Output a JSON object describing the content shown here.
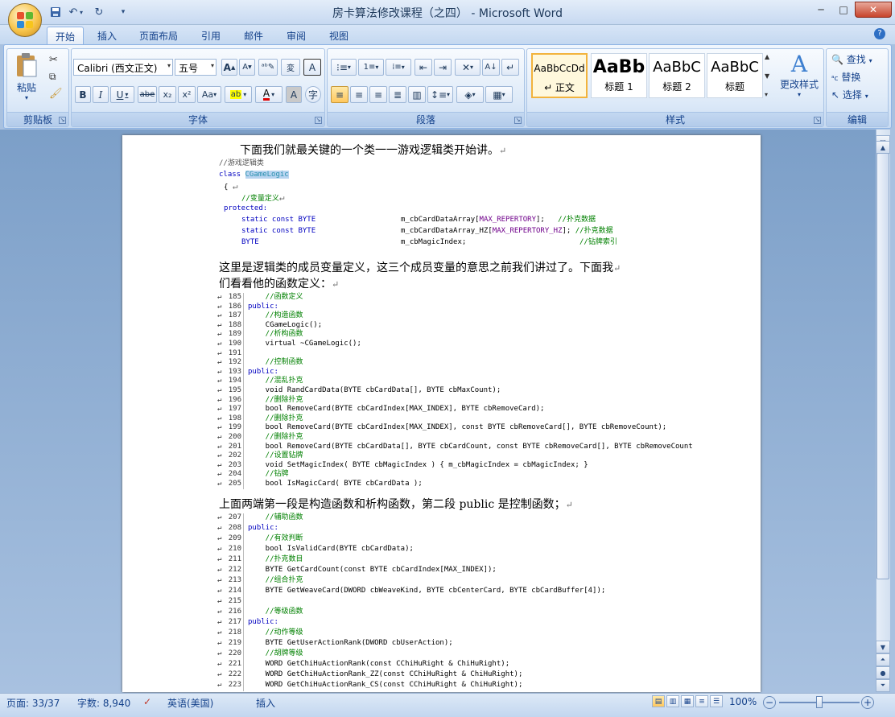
{
  "window": {
    "title": "房卡算法修改课程（之四） - Microsoft Word",
    "min_glyph": "─",
    "max_glyph": "□",
    "close_glyph": "✕"
  },
  "quick_access": {
    "save_icon": "save-icon",
    "undo_icon": "undo-icon",
    "redo_icon": "redo-icon"
  },
  "tabs": [
    "开始",
    "插入",
    "页面布局",
    "引用",
    "邮件",
    "审阅",
    "视图"
  ],
  "ribbon": {
    "clipboard": {
      "paste_label": "粘贴",
      "group_label": "剪贴板"
    },
    "font": {
      "font_name": "Calibri (西文正文)",
      "font_size": "五号",
      "group_label": "字体",
      "bold": "B",
      "italic": "I",
      "underline": "U",
      "strike": "abe",
      "sub": "x₂",
      "sup": "x²",
      "case": "Aa",
      "grow": "A",
      "shrink": "A"
    },
    "paragraph": {
      "group_label": "段落"
    },
    "styles": {
      "group_label": "样式",
      "change_styles": "更改样式",
      "items": [
        {
          "sample": "AaBbCcDd",
          "name": "↵ 正文"
        },
        {
          "sample": "AaBb",
          "name": "标题 1"
        },
        {
          "sample": "AaBbC",
          "name": "标题 2"
        },
        {
          "sample": "AaBbC",
          "name": "标题"
        }
      ]
    },
    "editing": {
      "group_label": "编辑",
      "find": "查找",
      "replace": "替换",
      "select": "选择"
    }
  },
  "document": {
    "para1": "下面我们就最关键的一个类一一游戏逻辑类开始讲。",
    "para2_line1": "这里是逻辑类的成员变量定义，这三个成员变量的意思之前我们讲过了。下面我",
    "para2_line2": "们看看他的函数定义：",
    "para3": "上面两端第一段是构造函数和析构函数，第二段 public 是控制函数；",
    "code1": {
      "l0": "//游戏逻辑类",
      "l1a": "class ",
      "l1b": "CGameLogic",
      "l2": "{",
      "l3": "//变量定义",
      "l4": "protected:",
      "l5a": "static const BYTE",
      "l5b": "m_cbCardDataArray[",
      "l5c": "MAX_REPERTORY",
      "l5d": "];",
      "l5e": "//扑克数据",
      "l6a": "static const BYTE",
      "l6b": "m_cbCardDataArray_HZ[",
      "l6c": "MAX_REPERTORY_HZ",
      "l6d": "];",
      "l6e": "//扑克数据",
      "l7a": "BYTE",
      "l7b": "m_cbMagicIndex;",
      "l7e": "//钻牌索引"
    },
    "code2": [
      {
        "n": "185",
        "t": "    //函数定义",
        "c": "cm"
      },
      {
        "n": "186",
        "t": "public:",
        "c": "kw"
      },
      {
        "n": "187",
        "t": "    //构造函数",
        "c": "cm"
      },
      {
        "n": "188",
        "t": "    CGameLogic();",
        "c": ""
      },
      {
        "n": "189",
        "t": "    //析构函数",
        "c": "cm"
      },
      {
        "n": "190",
        "t": "    virtual ~CGameLogic();",
        "c": ""
      },
      {
        "n": "191",
        "t": "",
        "c": ""
      },
      {
        "n": "192",
        "t": "    //控制函数",
        "c": "cm"
      },
      {
        "n": "193",
        "t": "public:",
        "c": "kw"
      },
      {
        "n": "194",
        "t": "    //混乱扑克",
        "c": "cm"
      },
      {
        "n": "195",
        "t": "    void RandCardData(BYTE cbCardData[], BYTE cbMaxCount);",
        "c": ""
      },
      {
        "n": "196",
        "t": "    //删除扑克",
        "c": "cm"
      },
      {
        "n": "197",
        "t": "    bool RemoveCard(BYTE cbCardIndex[MAX_INDEX], BYTE cbRemoveCard);",
        "c": ""
      },
      {
        "n": "198",
        "t": "    //删除扑克",
        "c": "cm"
      },
      {
        "n": "199",
        "t": "    bool RemoveCard(BYTE cbCardIndex[MAX_INDEX], const BYTE cbRemoveCard[], BYTE cbRemoveCount);",
        "c": ""
      },
      {
        "n": "200",
        "t": "    //删除扑克",
        "c": "cm"
      },
      {
        "n": "201",
        "t": "    bool RemoveCard(BYTE cbCardData[], BYTE cbCardCount, const BYTE cbRemoveCard[], BYTE cbRemoveCount",
        "c": ""
      },
      {
        "n": "202",
        "t": "    //设置钻牌",
        "c": "cm"
      },
      {
        "n": "203",
        "t": "    void SetMagicIndex( BYTE cbMagicIndex ) { m_cbMagicIndex = cbMagicIndex; }",
        "c": ""
      },
      {
        "n": "204",
        "t": "    //钻牌",
        "c": "cm"
      },
      {
        "n": "205",
        "t": "    bool IsMagicCard( BYTE cbCardData );",
        "c": ""
      }
    ],
    "code3": [
      {
        "n": "207",
        "t": "    //辅助函数",
        "c": "cm"
      },
      {
        "n": "208",
        "t": "public:",
        "c": "kw"
      },
      {
        "n": "209",
        "t": "    //有效判断",
        "c": "cm"
      },
      {
        "n": "210",
        "t": "    bool IsValidCard(BYTE cbCardData);",
        "c": ""
      },
      {
        "n": "211",
        "t": "    //扑克数目",
        "c": "cm"
      },
      {
        "n": "212",
        "t": "    BYTE GetCardCount(const BYTE cbCardIndex[MAX_INDEX]);",
        "c": ""
      },
      {
        "n": "213",
        "t": "    //组合扑克",
        "c": "cm"
      },
      {
        "n": "214",
        "t": "    BYTE GetWeaveCard(DWORD cbWeaveKind, BYTE cbCenterCard, BYTE cbCardBuffer[4]);",
        "c": ""
      },
      {
        "n": "215",
        "t": "",
        "c": ""
      },
      {
        "n": "216",
        "t": "    //等级函数",
        "c": "cm"
      },
      {
        "n": "217",
        "t": "public:",
        "c": "kw"
      },
      {
        "n": "218",
        "t": "    //动作等级",
        "c": "cm"
      },
      {
        "n": "219",
        "t": "    BYTE GetUserActionRank(DWORD cbUserAction);",
        "c": ""
      },
      {
        "n": "220",
        "t": "    //胡牌等级",
        "c": "cm"
      },
      {
        "n": "221",
        "t": "    WORD GetChiHuActionRank(const CChiHuRight & ChiHuRight);",
        "c": ""
      },
      {
        "n": "222",
        "t": "    WORD GetChiHuActionRank_ZZ(const CChiHuRight & ChiHuRight);",
        "c": ""
      },
      {
        "n": "223",
        "t": "    WORD GetChiHuActionRank_CS(const CChiHuRight & ChiHuRight);",
        "c": ""
      }
    ]
  },
  "status": {
    "page": "页面: 33/37",
    "words": "字数: 8,940",
    "language": "英语(美国)",
    "insert_mode": "插入",
    "zoom": "100%",
    "zoom_minus": "−",
    "zoom_plus": "+",
    "zoom_level": 0.5
  },
  "colors": {
    "accent": "#15428b",
    "ribbon": "#d7e6f7",
    "selection": "#b8d4f0"
  }
}
